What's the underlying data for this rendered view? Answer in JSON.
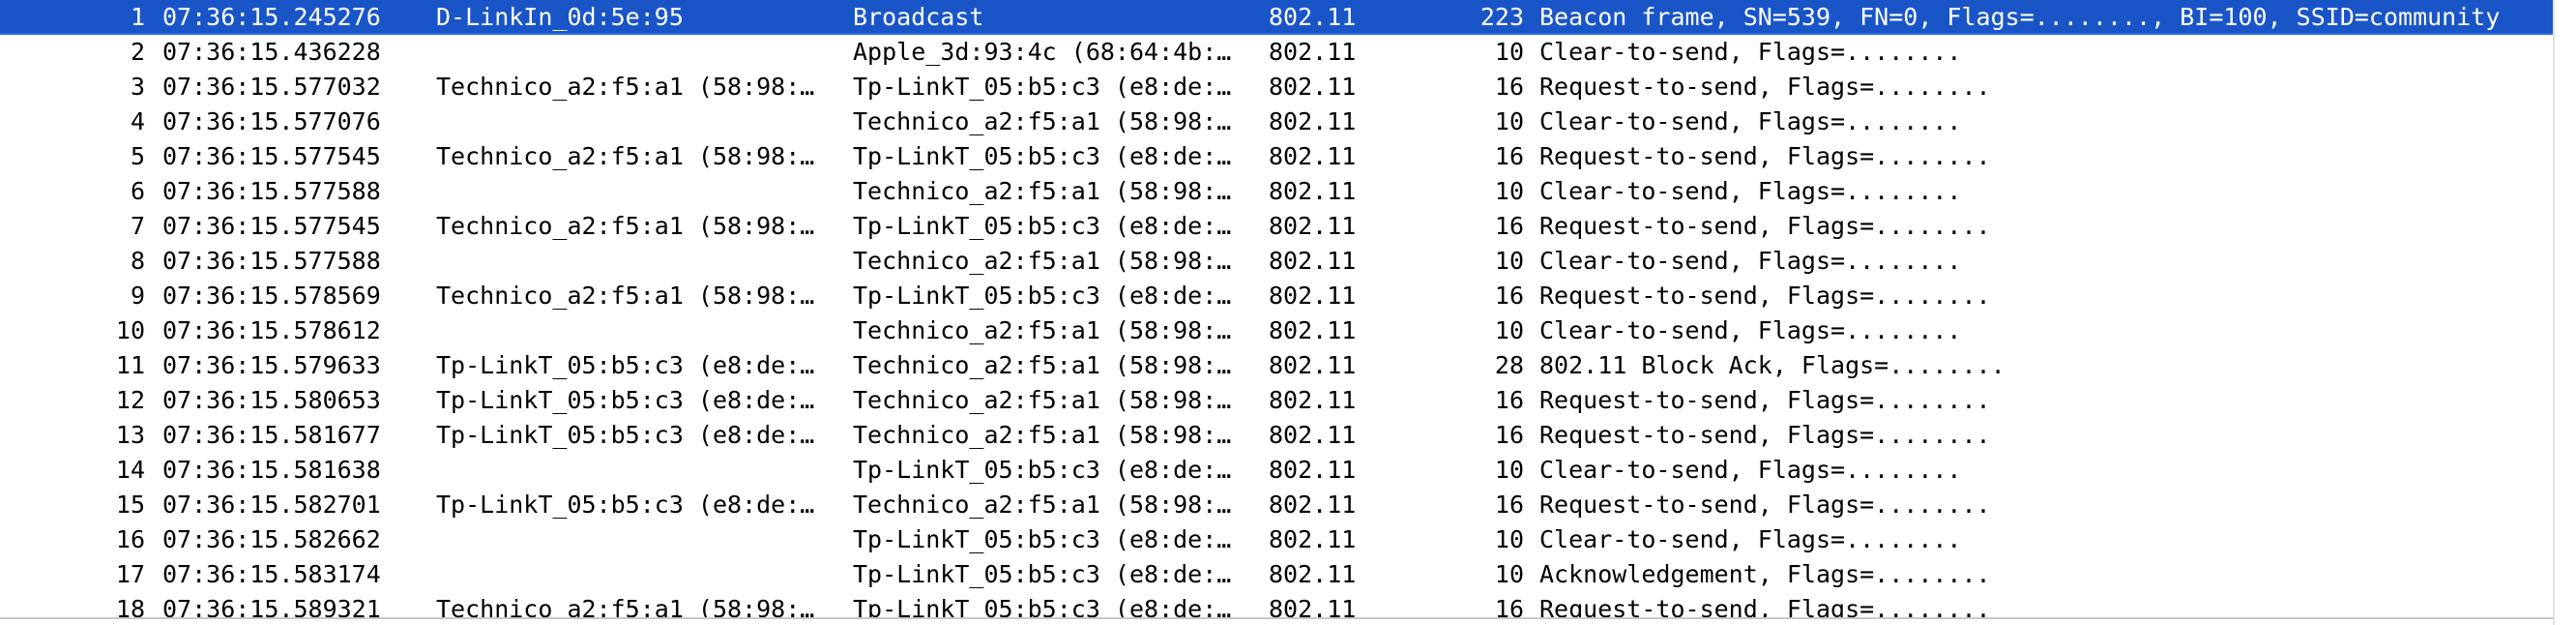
{
  "packets": [
    {
      "no": "1",
      "time": "07:36:15.245276",
      "source": "D-LinkIn_0d:5e:95",
      "destination": "Broadcast",
      "protocol": "802.11",
      "length": "223",
      "info": "Beacon frame, SN=539, FN=0, Flags=........, BI=100, SSID=community",
      "selected": true
    },
    {
      "no": "2",
      "time": "07:36:15.436228",
      "source": "",
      "destination": "Apple_3d:93:4c (68:64:4b:…",
      "protocol": "802.11",
      "length": "10",
      "info": "Clear-to-send, Flags=........"
    },
    {
      "no": "3",
      "time": "07:36:15.577032",
      "source": "Technico_a2:f5:a1 (58:98:…",
      "destination": "Tp-LinkT_05:b5:c3 (e8:de:…",
      "protocol": "802.11",
      "length": "16",
      "info": "Request-to-send, Flags=........"
    },
    {
      "no": "4",
      "time": "07:36:15.577076",
      "source": "",
      "destination": "Technico_a2:f5:a1 (58:98:…",
      "protocol": "802.11",
      "length": "10",
      "info": "Clear-to-send, Flags=........"
    },
    {
      "no": "5",
      "time": "07:36:15.577545",
      "source": "Technico_a2:f5:a1 (58:98:…",
      "destination": "Tp-LinkT_05:b5:c3 (e8:de:…",
      "protocol": "802.11",
      "length": "16",
      "info": "Request-to-send, Flags=........"
    },
    {
      "no": "6",
      "time": "07:36:15.577588",
      "source": "",
      "destination": "Technico_a2:f5:a1 (58:98:…",
      "protocol": "802.11",
      "length": "10",
      "info": "Clear-to-send, Flags=........"
    },
    {
      "no": "7",
      "time": "07:36:15.577545",
      "source": "Technico_a2:f5:a1 (58:98:…",
      "destination": "Tp-LinkT_05:b5:c3 (e8:de:…",
      "protocol": "802.11",
      "length": "16",
      "info": "Request-to-send, Flags=........"
    },
    {
      "no": "8",
      "time": "07:36:15.577588",
      "source": "",
      "destination": "Technico_a2:f5:a1 (58:98:…",
      "protocol": "802.11",
      "length": "10",
      "info": "Clear-to-send, Flags=........"
    },
    {
      "no": "9",
      "time": "07:36:15.578569",
      "source": "Technico_a2:f5:a1 (58:98:…",
      "destination": "Tp-LinkT_05:b5:c3 (e8:de:…",
      "protocol": "802.11",
      "length": "16",
      "info": "Request-to-send, Flags=........"
    },
    {
      "no": "10",
      "time": "07:36:15.578612",
      "source": "",
      "destination": "Technico_a2:f5:a1 (58:98:…",
      "protocol": "802.11",
      "length": "10",
      "info": "Clear-to-send, Flags=........"
    },
    {
      "no": "11",
      "time": "07:36:15.579633",
      "source": "Tp-LinkT_05:b5:c3 (e8:de:…",
      "destination": "Technico_a2:f5:a1 (58:98:…",
      "protocol": "802.11",
      "length": "28",
      "info": "802.11 Block Ack, Flags=........"
    },
    {
      "no": "12",
      "time": "07:36:15.580653",
      "source": "Tp-LinkT_05:b5:c3 (e8:de:…",
      "destination": "Technico_a2:f5:a1 (58:98:…",
      "protocol": "802.11",
      "length": "16",
      "info": "Request-to-send, Flags=........"
    },
    {
      "no": "13",
      "time": "07:36:15.581677",
      "source": "Tp-LinkT_05:b5:c3 (e8:de:…",
      "destination": "Technico_a2:f5:a1 (58:98:…",
      "protocol": "802.11",
      "length": "16",
      "info": "Request-to-send, Flags=........"
    },
    {
      "no": "14",
      "time": "07:36:15.581638",
      "source": "",
      "destination": "Tp-LinkT_05:b5:c3 (e8:de:…",
      "protocol": "802.11",
      "length": "10",
      "info": "Clear-to-send, Flags=........"
    },
    {
      "no": "15",
      "time": "07:36:15.582701",
      "source": "Tp-LinkT_05:b5:c3 (e8:de:…",
      "destination": "Technico_a2:f5:a1 (58:98:…",
      "protocol": "802.11",
      "length": "16",
      "info": "Request-to-send, Flags=........"
    },
    {
      "no": "16",
      "time": "07:36:15.582662",
      "source": "",
      "destination": "Tp-LinkT_05:b5:c3 (e8:de:…",
      "protocol": "802.11",
      "length": "10",
      "info": "Clear-to-send, Flags=........"
    },
    {
      "no": "17",
      "time": "07:36:15.583174",
      "source": "",
      "destination": "Tp-LinkT_05:b5:c3 (e8:de:…",
      "protocol": "802.11",
      "length": "10",
      "info": "Acknowledgement, Flags=........"
    },
    {
      "no": "18",
      "time": "07:36:15.589321",
      "source": "Technico_a2:f5:a1 (58:98:…",
      "destination": "Tp-LinkT_05:b5:c3 (e8:de:…",
      "protocol": "802.11",
      "length": "16",
      "info": "Request-to-send, Flags=........"
    }
  ],
  "colors": {
    "selected_row_background": "#1a55c8",
    "selected_row_text": "#ffffff",
    "row_background": "#ffffff",
    "row_text": "#000000"
  }
}
